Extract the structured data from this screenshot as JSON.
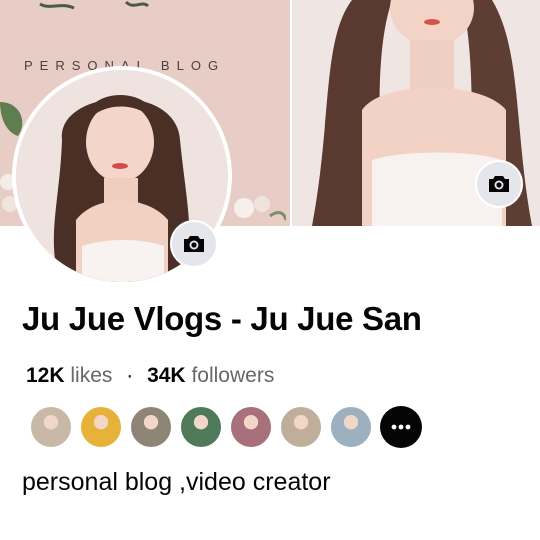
{
  "cover": {
    "blog_title": "PERSONAL BLOG",
    "colors": {
      "left_bg": "#e8ccc6",
      "right_bg": "#efe6e4"
    }
  },
  "profile": {
    "page_name": "Ju Jue Vlogs - Ju Jue San",
    "likes_count": "12K",
    "likes_label": "likes",
    "separator": "·",
    "followers_count": "34K",
    "followers_label": "followers",
    "bio": "personal blog ,video creator"
  },
  "icons": {
    "profile_camera": "camera-icon",
    "cover_camera": "camera-icon",
    "more": "more-dots-icon"
  },
  "followers_preview": [
    {
      "name": "follower-avatar-1",
      "color": "#c8b9a6"
    },
    {
      "name": "follower-avatar-2",
      "color": "#e6b23a"
    },
    {
      "name": "follower-avatar-3",
      "color": "#8e8577"
    },
    {
      "name": "follower-avatar-4",
      "color": "#4f7a5a"
    },
    {
      "name": "follower-avatar-5",
      "color": "#a7707a"
    },
    {
      "name": "follower-avatar-6",
      "color": "#bfae99"
    },
    {
      "name": "follower-avatar-7",
      "color": "#9db0bf"
    }
  ]
}
